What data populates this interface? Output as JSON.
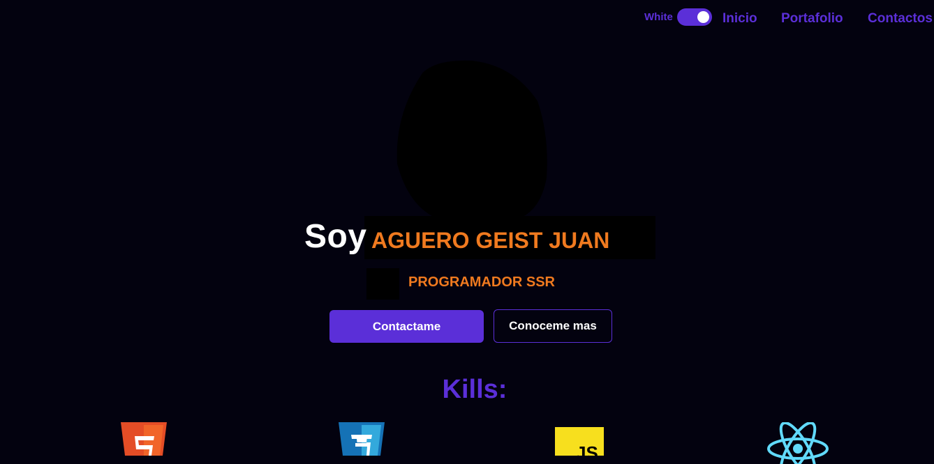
{
  "header": {
    "theme_toggle_label": "White",
    "nav": {
      "inicio": "Inicio",
      "portafolio": "Portafolio",
      "contactos": "Contactos"
    }
  },
  "hero": {
    "prefix": "Soy",
    "name": "AGUERO GEIST JUAN",
    "role": "PROGRAMADOR SSR",
    "buttons": {
      "primary": "Contactame",
      "secondary": "Conoceme mas"
    }
  },
  "skills": {
    "title": "Kills:",
    "items": [
      {
        "icon": "html5-icon"
      },
      {
        "icon": "css3-icon"
      },
      {
        "icon": "javascript-icon",
        "label": "JS"
      },
      {
        "icon": "react-icon"
      }
    ]
  },
  "colors": {
    "background": "#03020f",
    "accent": "#5b2fd8",
    "highlight": "#f07a1f"
  }
}
